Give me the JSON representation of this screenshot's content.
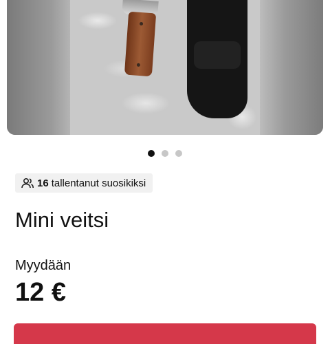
{
  "gallery": {
    "image_alt": "knife with wooden handle and black sheath",
    "slide_count": 3,
    "active_slide": 1
  },
  "favorites": {
    "count": "16",
    "label": "tallentanut suosikiksi",
    "icon": "users-icon"
  },
  "listing": {
    "title": "Mini veitsi",
    "sale_type": "Myydään",
    "price": "12 €"
  },
  "colors": {
    "accent": "#d5384a",
    "badge_bg": "#f1f1f1",
    "dot_active": "#111111",
    "dot_inactive": "#c7c7c7"
  }
}
